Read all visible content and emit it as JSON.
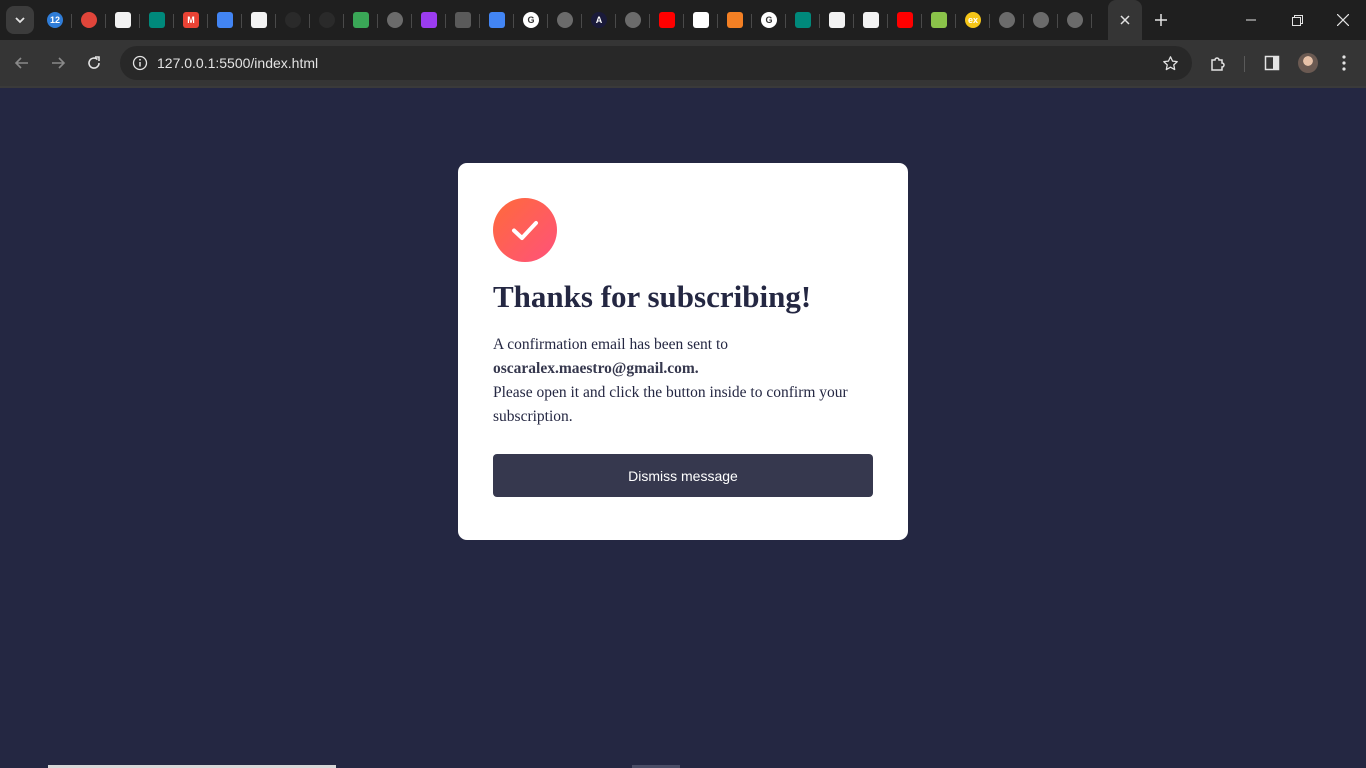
{
  "browser": {
    "url": "127.0.0.1:5500/index.html",
    "pinned_tabs": [
      {
        "icon": "badge-12-icon",
        "color": "#2f7dd8",
        "glyph": "12",
        "round": true
      },
      {
        "icon": "google-chrome-record-icon",
        "color": "#e0453a",
        "glyph": "",
        "round": true
      },
      {
        "icon": "blank-page-icon",
        "color": "#f2f2f2",
        "glyph": "",
        "round": false
      },
      {
        "icon": "google-meet-icon",
        "color": "#00897b",
        "glyph": "",
        "round": false
      },
      {
        "icon": "gmail-icon",
        "color": "#ea4335",
        "glyph": "M",
        "round": false
      },
      {
        "icon": "google-docs-icon",
        "color": "#4285f4",
        "glyph": "",
        "round": false
      },
      {
        "icon": "blank-page-icon",
        "color": "#f2f2f2",
        "glyph": "",
        "round": false
      },
      {
        "icon": "github-icon",
        "color": "#2a2a2a",
        "glyph": "",
        "round": true
      },
      {
        "icon": "github-icon",
        "color": "#2a2a2a",
        "glyph": "",
        "round": true
      },
      {
        "icon": "translate-icon",
        "color": "#3aa757",
        "glyph": "",
        "round": false
      },
      {
        "icon": "globe-icon",
        "color": "#6b6b6b",
        "glyph": "",
        "round": true
      },
      {
        "icon": "cube-icon",
        "color": "#9b3cf0",
        "glyph": "",
        "round": false
      },
      {
        "icon": "figma-icon",
        "color": "#5a5a5a",
        "glyph": "",
        "round": false
      },
      {
        "icon": "google-docs-icon",
        "color": "#4285f4",
        "glyph": "",
        "round": false
      },
      {
        "icon": "google-icon",
        "color": "#ffffff",
        "glyph": "G",
        "round": true
      },
      {
        "icon": "globe-icon",
        "color": "#6b6b6b",
        "glyph": "",
        "round": true
      },
      {
        "icon": "angular-icon",
        "color": "#1a1a3a",
        "glyph": "A",
        "round": true
      },
      {
        "icon": "globe-icon",
        "color": "#6b6b6b",
        "glyph": "",
        "round": true
      },
      {
        "icon": "youtube-icon",
        "color": "#ff0000",
        "glyph": "",
        "round": false
      },
      {
        "icon": "codepen-icon",
        "color": "#ffffff",
        "glyph": "",
        "round": false
      },
      {
        "icon": "stackoverflow-icon",
        "color": "#f48024",
        "glyph": "",
        "round": false
      },
      {
        "icon": "google-icon",
        "color": "#ffffff",
        "glyph": "G",
        "round": true
      },
      {
        "icon": "google-meet-icon",
        "color": "#00897b",
        "glyph": "",
        "round": false
      },
      {
        "icon": "blank-page-icon",
        "color": "#f2f2f2",
        "glyph": "",
        "round": false
      },
      {
        "icon": "blank-page-icon",
        "color": "#f2f2f2",
        "glyph": "",
        "round": false
      },
      {
        "icon": "youtube-icon",
        "color": "#ff0000",
        "glyph": "",
        "round": false
      },
      {
        "icon": "download-arrow-icon",
        "color": "#8bc34a",
        "glyph": "",
        "round": false
      },
      {
        "icon": "ex-badge-icon",
        "color": "#f5c518",
        "glyph": "ex",
        "round": true
      },
      {
        "icon": "globe-icon",
        "color": "#6b6b6b",
        "glyph": "",
        "round": true
      },
      {
        "icon": "globe-icon",
        "color": "#6b6b6b",
        "glyph": "",
        "round": true
      },
      {
        "icon": "globe-icon",
        "color": "#6b6b6b",
        "glyph": "",
        "round": true
      }
    ]
  },
  "page": {
    "background": "#242742",
    "card": {
      "title": "Thanks for subscribing!",
      "line1": "A confirmation email has been sent to",
      "email": "oscaralex.maestro@gmail.com.",
      "line2": "Please open it and click the button inside to confirm your subscription.",
      "button_label": "Dismiss message",
      "icon": "checkmark-icon",
      "accent_from": "#ff6a3a",
      "accent_to": "#ff527b"
    }
  }
}
